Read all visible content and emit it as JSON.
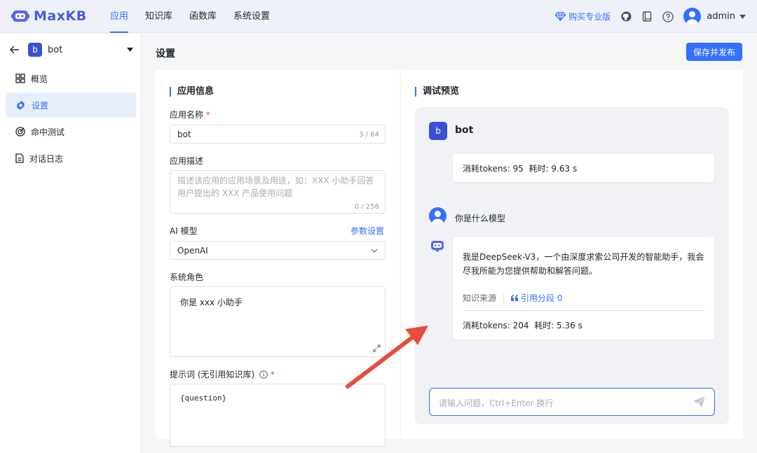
{
  "brand": {
    "name": "MaxKB"
  },
  "nav": {
    "items": [
      "应用",
      "知识库",
      "函数库",
      "系统设置"
    ],
    "active": 0
  },
  "topright": {
    "buy_label": "购买专业版",
    "user": "admin"
  },
  "sidebar": {
    "app_badge": "b",
    "app_name": "bot",
    "items": [
      {
        "label": "概览",
        "icon": "grid-icon"
      },
      {
        "label": "设置",
        "icon": "gear-icon",
        "active": true
      },
      {
        "label": "命中测试",
        "icon": "target-icon"
      },
      {
        "label": "对话日志",
        "icon": "document-icon"
      }
    ]
  },
  "page": {
    "title": "设置",
    "publish_label": "保存并发布"
  },
  "form": {
    "section_title": "应用信息",
    "name_label": "应用名称",
    "required_mark": "*",
    "name_value": "bot",
    "name_counter": "3 / 64",
    "desc_label": "应用描述",
    "desc_placeholder": "描述该应用的应用场景及用途，如：XXX 小助手回答用户提出的 XXX 产品使用问题",
    "desc_counter": "0 / 256",
    "model_label": "AI 模型",
    "model_settings_link": "参数设置",
    "model_value": "OpenAI",
    "role_label": "系统角色",
    "role_value": "你是 xxx 小助手",
    "prompt_label": "提示词 (无引用知识库)",
    "prompt_value": "{question}"
  },
  "preview": {
    "section_title": "调试预览",
    "bot_badge": "b",
    "bot_name": "bot",
    "prev_stats": "消耗tokens: 95  耗时: 9.63 s",
    "question": "你是什么模型",
    "answer": "我是DeepSeek-V3，一个由深度求索公司开发的智能助手，我会尽我所能为您提供帮助和解答问题。",
    "source_label": "知识来源",
    "quote_label": "引用分段 0",
    "stats": "消耗tokens: 204  耗时: 5.36 s",
    "input_placeholder": "请输入问题，Ctrl+Enter 换行"
  },
  "colors": {
    "primary": "#3370ff",
    "brand": "#4a5cd4",
    "annotation_arrow": "#e84c3d"
  }
}
